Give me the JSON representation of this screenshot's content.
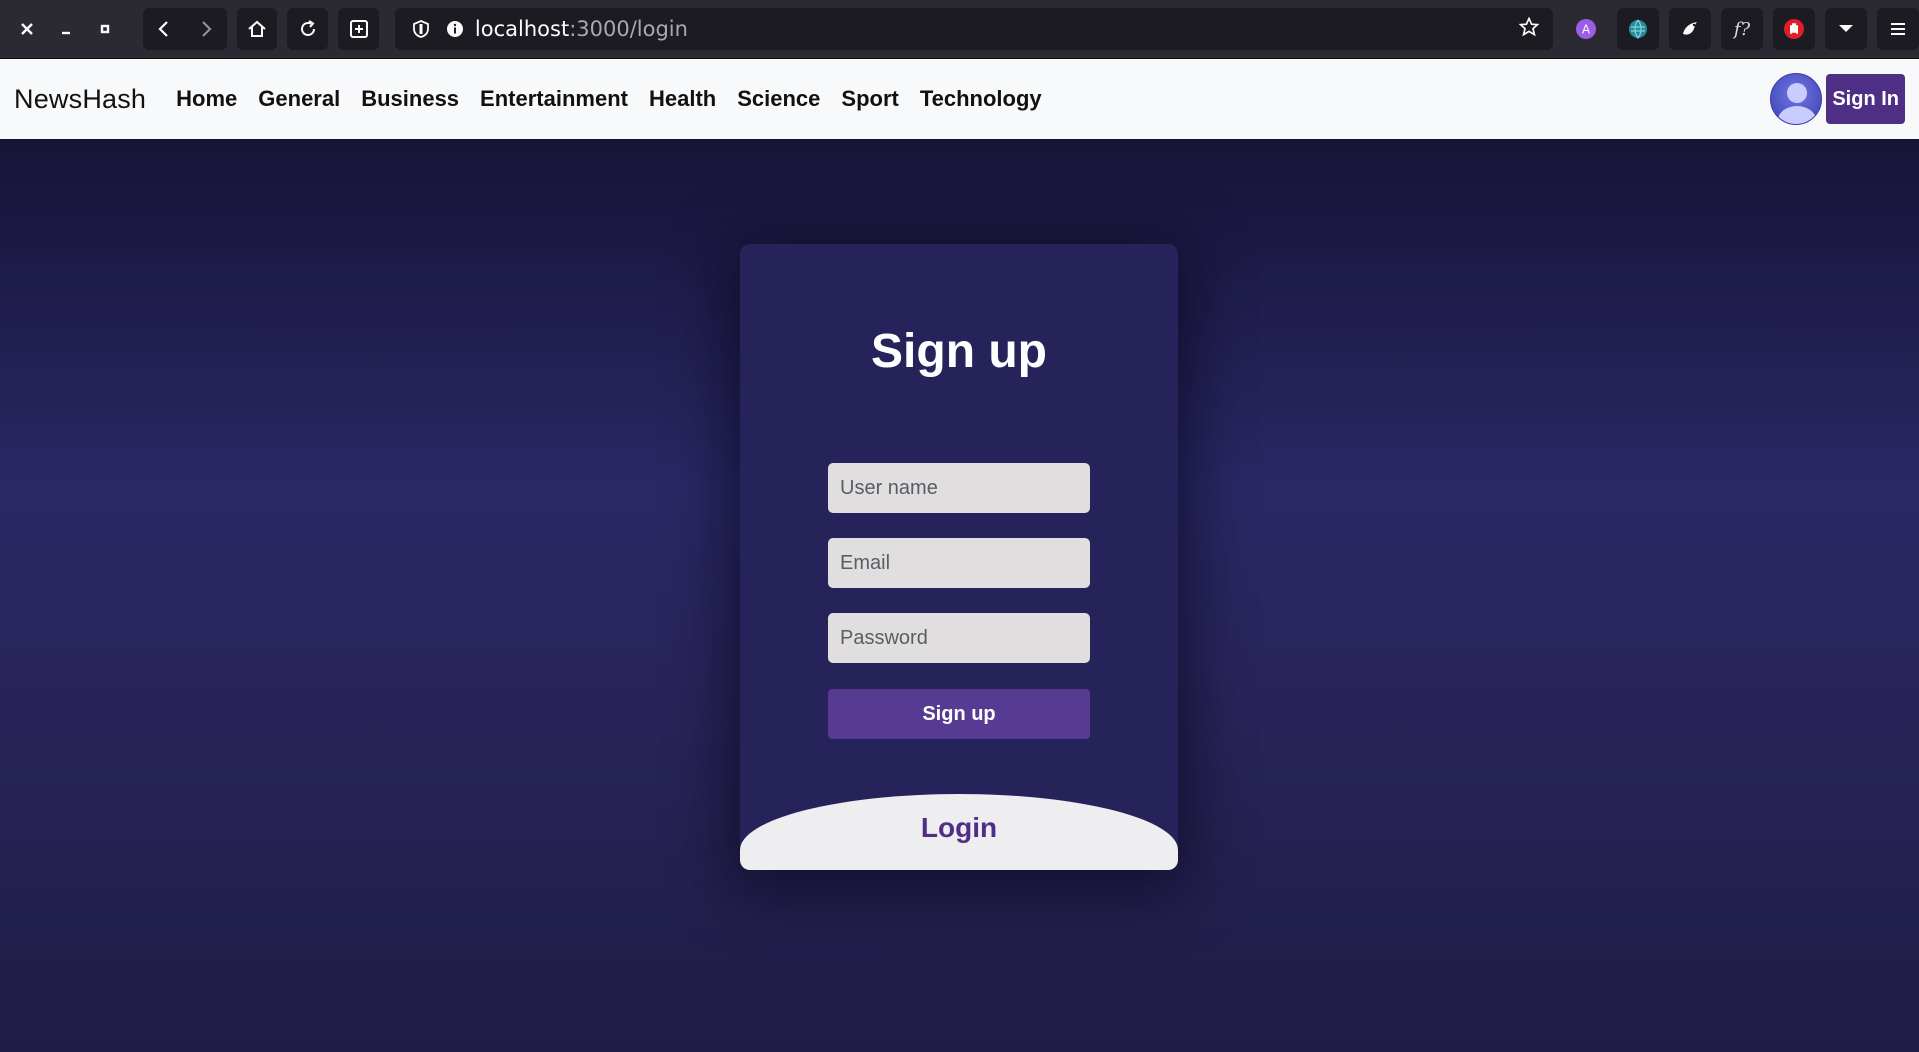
{
  "browser": {
    "url_host": "localhost",
    "url_path": ":3000/login",
    "extension_badge": "A",
    "extension_formula": "f?"
  },
  "navbar": {
    "brand": "NewsHash",
    "links": [
      "Home",
      "General",
      "Business",
      "Entertainment",
      "Health",
      "Science",
      "Sport",
      "Technology"
    ],
    "signin_label": "Sign In"
  },
  "form": {
    "title": "Sign up",
    "username_placeholder": "User name",
    "email_placeholder": "Email",
    "password_placeholder": "Password",
    "submit_label": "Sign up",
    "login_label": "Login"
  },
  "colors": {
    "accent": "#4f2f86",
    "card": "#26225a",
    "background": "#2a2765"
  }
}
